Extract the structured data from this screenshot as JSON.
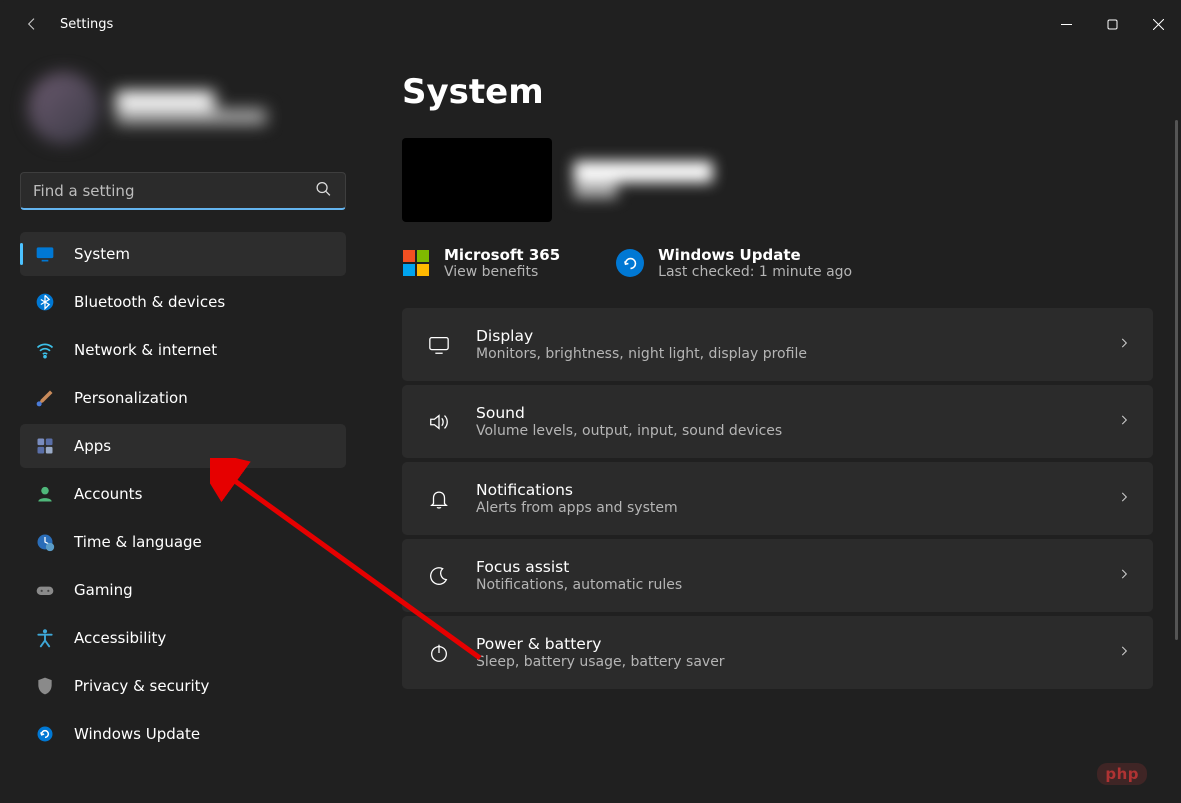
{
  "titlebar": {
    "title": "Settings"
  },
  "profile": {
    "name": "████████",
    "email": "███████████████"
  },
  "search": {
    "placeholder": "Find a setting"
  },
  "sidebar": {
    "items": [
      {
        "label": "System",
        "icon": "display-icon",
        "state": "selected"
      },
      {
        "label": "Bluetooth & devices",
        "icon": "bluetooth-icon",
        "state": ""
      },
      {
        "label": "Network & internet",
        "icon": "wifi-icon",
        "state": ""
      },
      {
        "label": "Personalization",
        "icon": "brush-icon",
        "state": ""
      },
      {
        "label": "Apps",
        "icon": "apps-icon",
        "state": "hover"
      },
      {
        "label": "Accounts",
        "icon": "person-icon",
        "state": ""
      },
      {
        "label": "Time & language",
        "icon": "clock-globe-icon",
        "state": ""
      },
      {
        "label": "Gaming",
        "icon": "gamepad-icon",
        "state": ""
      },
      {
        "label": "Accessibility",
        "icon": "accessibility-icon",
        "state": ""
      },
      {
        "label": "Privacy & security",
        "icon": "shield-icon",
        "state": ""
      },
      {
        "label": "Windows Update",
        "icon": "update-icon",
        "state": ""
      }
    ]
  },
  "main": {
    "heading": "System",
    "device": {
      "name": "██████████",
      "model": "████"
    },
    "promos": [
      {
        "title": "Microsoft 365",
        "sub": "View benefits",
        "icon": "ms365-icon"
      },
      {
        "title": "Windows Update",
        "sub": "Last checked: 1 minute ago",
        "icon": "windows-update-icon"
      }
    ],
    "cards": [
      {
        "title": "Display",
        "sub": "Monitors, brightness, night light, display profile",
        "icon": "display-icon"
      },
      {
        "title": "Sound",
        "sub": "Volume levels, output, input, sound devices",
        "icon": "sound-icon"
      },
      {
        "title": "Notifications",
        "sub": "Alerts from apps and system",
        "icon": "bell-icon"
      },
      {
        "title": "Focus assist",
        "sub": "Notifications, automatic rules",
        "icon": "moon-icon"
      },
      {
        "title": "Power & battery",
        "sub": "Sleep, battery usage, battery saver",
        "icon": "power-icon"
      }
    ]
  },
  "watermark": "php"
}
